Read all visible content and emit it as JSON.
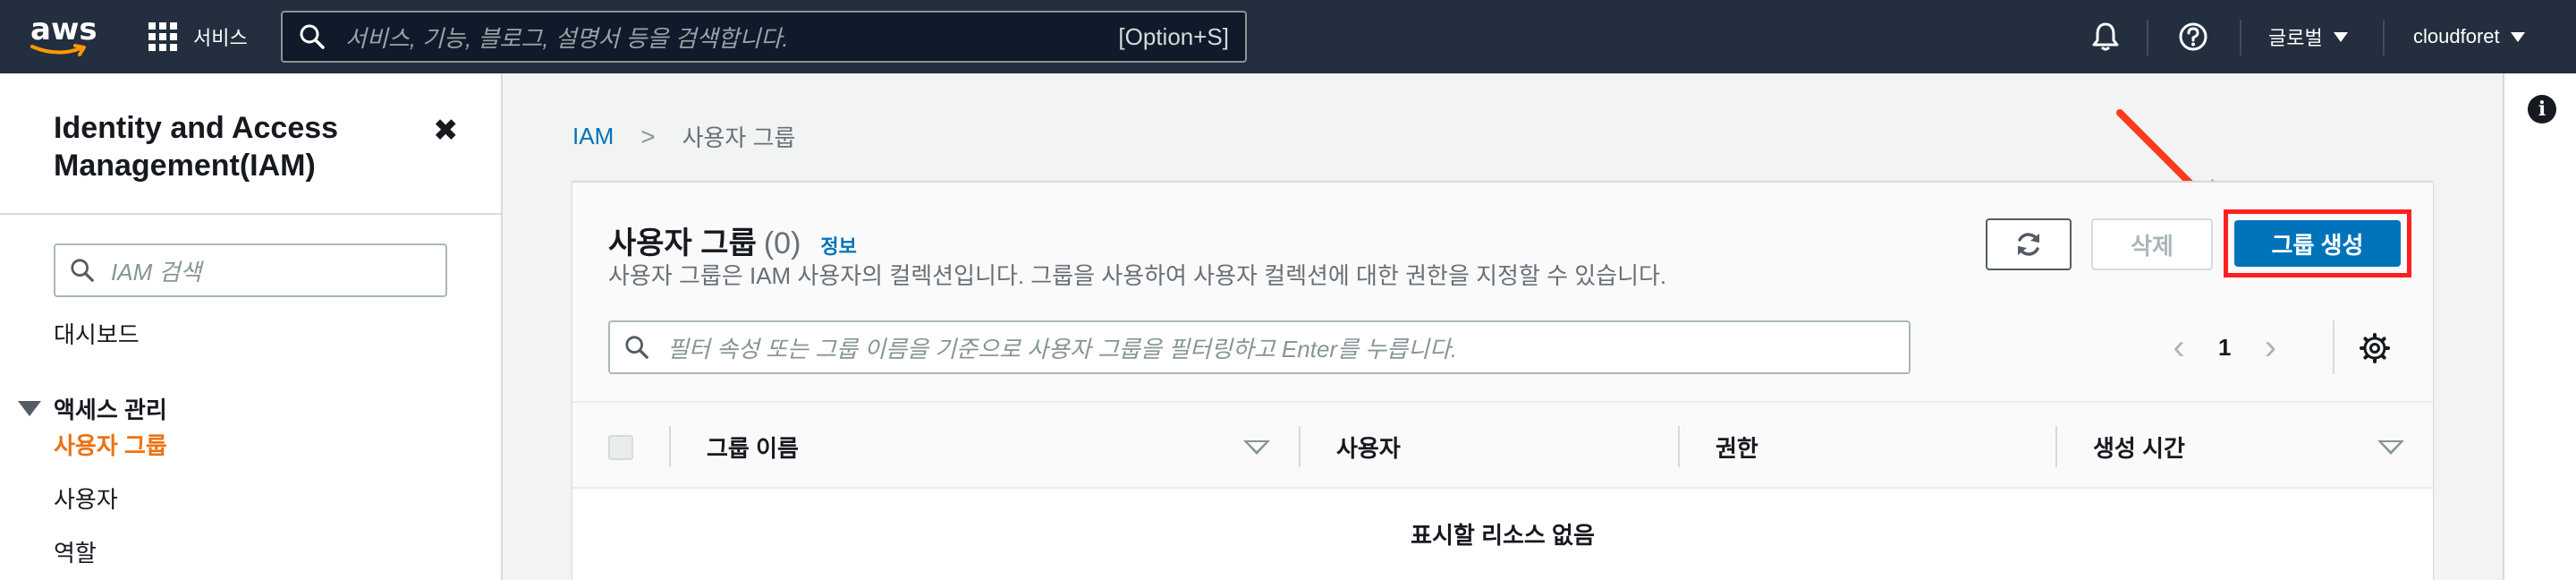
{
  "topnav": {
    "logo_text": "aws",
    "services_label": "서비스",
    "search_placeholder": "서비스, 기능, 블로그, 설명서 등을 검색합니다.",
    "search_shortcut": "[Option+S]",
    "region_label": "글로벌",
    "account_label": "cloudforet"
  },
  "sidebar": {
    "title": "Identity and Access Management(IAM)",
    "close_glyph": "✖",
    "search_placeholder": "IAM 검색",
    "dashboard": "대시보드",
    "section_access": "액세스 관리",
    "items": [
      {
        "label": "사용자 그룹",
        "active": true
      },
      {
        "label": "사용자",
        "active": false
      },
      {
        "label": "역할",
        "active": false
      }
    ]
  },
  "breadcrumb": {
    "root": "IAM",
    "separator": ">",
    "current": "사용자 그룹"
  },
  "panel": {
    "title": "사용자 그룹",
    "count": "(0)",
    "info_link": "정보",
    "description": "사용자 그룹은 IAM 사용자의 컬렉션입니다. 그룹을 사용하여 사용자 컬렉션에 대한 권한을 지정할 수 있습니다.",
    "delete_label": "삭제",
    "create_label": "그룹 생성",
    "filter_placeholder": "필터 속성 또는 그룹 이름을 기준으로 사용자 그룹을 필터링하고 Enter를 누릅니다.",
    "page_number": "1",
    "columns": [
      "그룹 이름",
      "사용자",
      "권한",
      "생성 시간"
    ],
    "empty_text": "표시할 리소스 없음"
  },
  "colors": {
    "nav_bg": "#232f3e",
    "primary": "#0073bb",
    "active_orange": "#ec7211",
    "highlight_red": "#ff1f1f"
  },
  "icons": [
    "grid-icon",
    "search-icon",
    "bell-icon",
    "help-icon",
    "close-icon",
    "refresh-icon",
    "settings-icon",
    "info-icon",
    "annotation-arrow"
  ]
}
